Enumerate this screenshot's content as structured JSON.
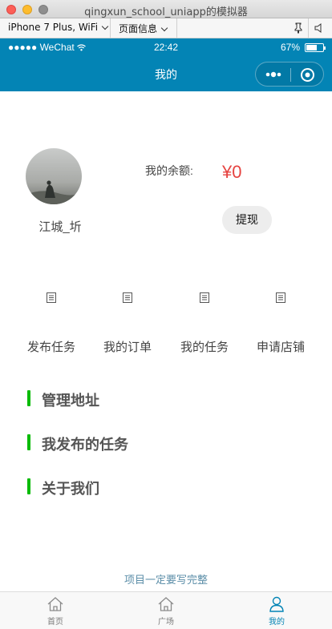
{
  "window": {
    "title": "qingxun_school_uniapp的模拟器"
  },
  "simulator_toolbar": {
    "device": "iPhone 7 Plus, WiFi",
    "page_info": "页面信息"
  },
  "status_bar": {
    "carrier": "●●●●● WeChat",
    "time": "22:42",
    "battery_percent": "67%",
    "battery_level": 0.67
  },
  "nav_bar": {
    "title": "我的"
  },
  "profile": {
    "username": "江城_圻",
    "balance_label": "我的余额:",
    "balance_value": "¥0",
    "withdraw_label": "提现"
  },
  "quick_actions": [
    {
      "label": "发布任务",
      "icon": "document-icon"
    },
    {
      "label": "我的订单",
      "icon": "document-icon"
    },
    {
      "label": "我的任务",
      "icon": "document-icon"
    },
    {
      "label": "申请店铺",
      "icon": "document-icon"
    }
  ],
  "menu": [
    {
      "label": "管理地址"
    },
    {
      "label": "我发布的任务"
    },
    {
      "label": "关于我们"
    }
  ],
  "footer_note": "项目一定要写完整",
  "tab_bar": {
    "tabs": [
      {
        "label": "首页",
        "icon": "home-icon",
        "active": false
      },
      {
        "label": "广场",
        "icon": "home-icon",
        "active": false
      },
      {
        "label": "我的",
        "icon": "user-icon",
        "active": true
      }
    ]
  },
  "colors": {
    "nav_bg": "#0384b5",
    "accent_green": "#09bb07",
    "balance_red": "#e64340",
    "tab_active": "#0384b5"
  }
}
